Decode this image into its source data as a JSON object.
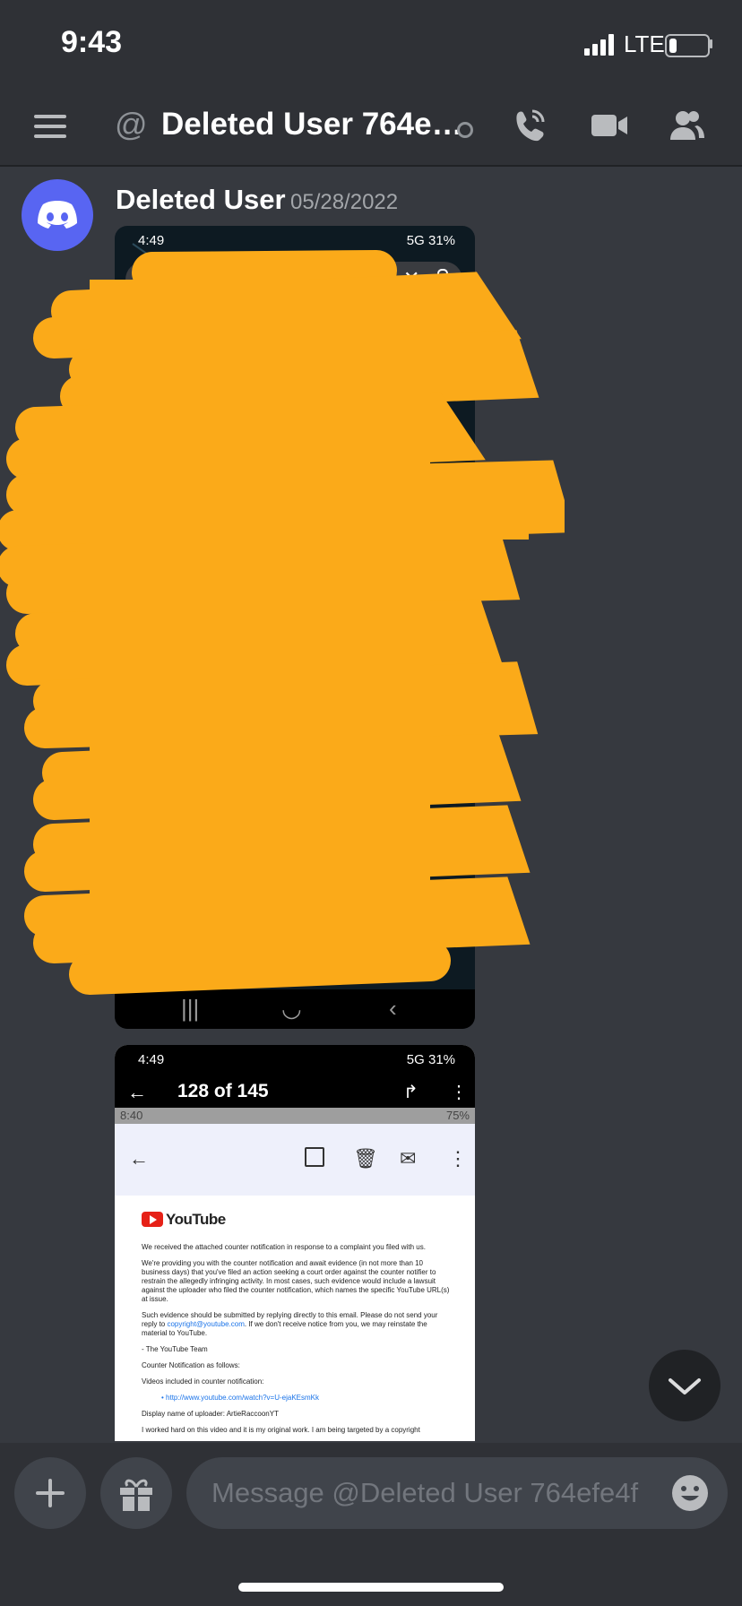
{
  "status_bar": {
    "time": "9:43",
    "network": "LTE",
    "battery_level": 0.2
  },
  "header": {
    "channel_title": "Deleted User 764e…",
    "icons": [
      "menu-icon",
      "at-icon",
      "status-icon",
      "call-icon",
      "video-icon",
      "members-icon"
    ]
  },
  "message": {
    "author": "Deleted User",
    "timestamp": "05/28/2022",
    "avatar_icon": "discord-logo-icon",
    "avatar_color": "#5865f2"
  },
  "attachment1": {
    "status_time": "4:49",
    "status_right": "5G 31%",
    "redaction_color": "#fbaa19"
  },
  "attachment2": {
    "status_time": "4:49",
    "status_right": "5G 31%",
    "email_count": "128 of 145",
    "inner_status_time": "8:40",
    "inner_battery": "75%",
    "email": {
      "brand": "YouTube",
      "p1": "We received the attached counter notification in response to a complaint you filed with us.",
      "p2": "We're providing you with the counter notification and await evidence (in not more than 10 business days) that you've filed an action seeking a court order against the counter notifier to restrain the allegedly infringing activity. In most cases, such evidence would include a lawsuit against the uploader who filed the counter notification, which names the specific YouTube URL(s) at issue.",
      "p3_before": "Such evidence should be submitted by replying directly to this email. Please do not send your reply to ",
      "p3_link": "copyright@youtube.com",
      "p3_after": ". If we don't receive notice from you, we may reinstate the material to YouTube.",
      "sign": "- The YouTube Team",
      "counter_heading": "Counter Notification as follows:",
      "videos_heading": "Videos included in counter notification:",
      "video_link": "http://www.youtube.com/watch?v=U-ejaKEsmKk",
      "uploader": "Display name of uploader: ArtieRaccoonYT",
      "statement": "I worked hard on this video and it is my original work. I am being targeted by a copyright"
    }
  },
  "composer": {
    "placeholder": "Message @Deleted User 764efe4f"
  }
}
